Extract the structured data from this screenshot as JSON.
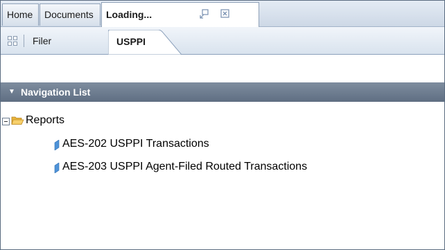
{
  "top_tabs": [
    {
      "label": "Home"
    },
    {
      "label": "Documents"
    },
    {
      "label": "Loading...",
      "active": true
    }
  ],
  "sub_tabs": [
    {
      "label": "Filer"
    },
    {
      "label": "USPPI",
      "active": true
    }
  ],
  "navigation": {
    "title": "Navigation List",
    "tree": {
      "folder_label": "Reports",
      "items": [
        {
          "label": "AES-202 USPPI Transactions"
        },
        {
          "label": "AES-203 USPPI Agent-Filed Routed Transactions"
        }
      ]
    }
  },
  "icons": {
    "popout": "popout-icon",
    "close": "close-icon",
    "grid": "grid-icon",
    "collapse": "triangle-down-icon",
    "folder": "open-folder-icon",
    "report": "report-icon",
    "tree_toggle": "minus-box-icon"
  },
  "colors": {
    "nav_header": "#6b7a8d",
    "tab_bar": "#d7e0eb",
    "report_icon": "#4f93d8",
    "folder": "#f2c14e"
  }
}
